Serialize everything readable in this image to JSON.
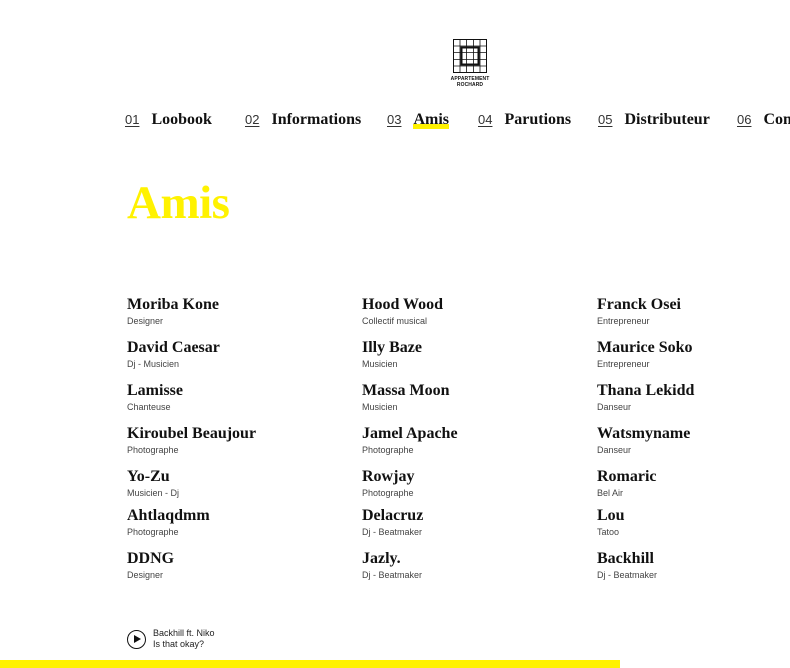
{
  "logo": {
    "line1": "APPARTEMENT",
    "line2": "ROCHARD"
  },
  "nav": [
    {
      "num": "01",
      "label": "Loobook",
      "active": false
    },
    {
      "num": "02",
      "label": "Informations",
      "active": false
    },
    {
      "num": "03",
      "label": "Amis",
      "active": true
    },
    {
      "num": "04",
      "label": "Parutions",
      "active": false
    },
    {
      "num": "05",
      "label": "Distributeur",
      "active": false
    },
    {
      "num": "06",
      "label": "Con",
      "active": false
    }
  ],
  "page_title": "Amis",
  "friends": {
    "col1": [
      {
        "name": "Moriba Kone",
        "role": "Designer"
      },
      {
        "name": "David Caesar",
        "role": "Dj - Musicien"
      },
      {
        "name": "Lamisse",
        "role": "Chanteuse"
      },
      {
        "name": "Kiroubel Beaujour",
        "role": "Photographe"
      },
      {
        "name": "Yo-Zu",
        "role": "Musicien - Dj"
      },
      {
        "name": "Ahtlaqdmm",
        "role": "Photographe"
      },
      {
        "name": "DDNG",
        "role": "Designer"
      }
    ],
    "col2": [
      {
        "name": "Hood Wood",
        "role": "Collectif musical"
      },
      {
        "name": "Illy Baze",
        "role": "Musicien"
      },
      {
        "name": "Massa Moon",
        "role": "Musicien"
      },
      {
        "name": "Jamel Apache",
        "role": "Photographe"
      },
      {
        "name": "Rowjay",
        "role": "Photographe"
      },
      {
        "name": "Delacruz",
        "role": "Dj - Beatmaker"
      },
      {
        "name": "Jazly.",
        "role": "Dj - Beatmaker"
      }
    ],
    "col3": [
      {
        "name": "Franck Osei",
        "role": "Entrepreneur"
      },
      {
        "name": "Maurice Soko",
        "role": "Entrepreneur"
      },
      {
        "name": "Thana Lekidd",
        "role": "Danseur"
      },
      {
        "name": "Watsmyname",
        "role": "Danseur"
      },
      {
        "name": "Romaric",
        "role": "Bel Air"
      },
      {
        "name": "Lou",
        "role": "Tatoo"
      },
      {
        "name": "Backhill",
        "role": "Dj - Beatmaker"
      }
    ]
  },
  "player": {
    "track_title": "Backhill ft. Niko",
    "track_subtitle": "Is that okay?",
    "play_icon": "play-icon",
    "progress": 0.785
  },
  "colors": {
    "accent": "#fff200",
    "text": "#111111"
  }
}
